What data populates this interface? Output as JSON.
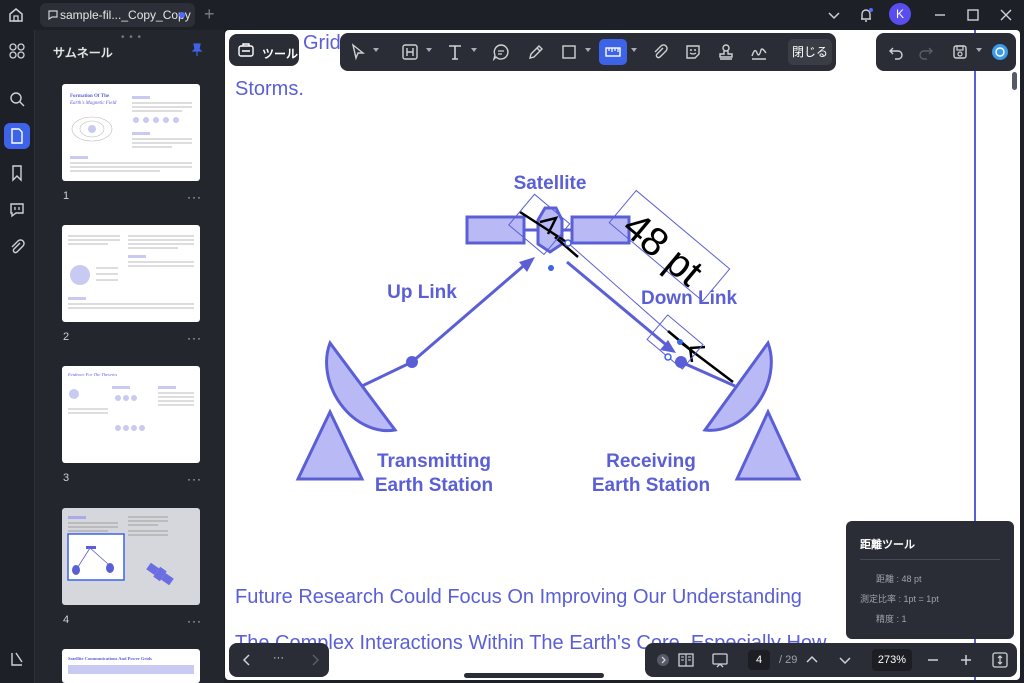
{
  "titlebar": {
    "tab_label": "sample-fil..._Copy_Copy",
    "avatar_letter": "K"
  },
  "sidebar": {
    "title": "サムネール",
    "pages": [
      "1",
      "2",
      "3",
      "4"
    ],
    "more_label": "···",
    "thumb1_heading": "Formation Of The",
    "thumb1_subheading": "Earth's Magnetic Field",
    "thumb3_heading": "Evidence For The Theories",
    "thumb5_heading": "Satellite Communications And Power Grids"
  },
  "toolbar": {
    "tool_label": "ツール",
    "close_label": "閉じる"
  },
  "document": {
    "heading_fragment": "Grid",
    "storms_text": "Storms.",
    "satellite_label": "Satellite",
    "uplink_label": "Up Link",
    "downlink_label": "Down Link",
    "transmit_line1": "Transmitting",
    "transmit_line2": "Earth Station",
    "receive_line1": "Receiving",
    "receive_line2": "Earth Station",
    "measure_label": "48 pt",
    "body_line1": "Future Research Could Focus On Improving Our Understanding",
    "body_line2": "The Complex Interactions Within The Earth's Core, Especially How"
  },
  "distance_panel": {
    "title": "距離ツール",
    "distance_label": "距離 : 48 pt",
    "scale_label": "測定比率 : 1pt = 1pt",
    "precision_label": "精度 : 1"
  },
  "bottom": {
    "nav_more": "···",
    "current_page": "4",
    "total_pages": "/ 29",
    "zoom": "273%"
  },
  "colors": {
    "accent": "#3d63e8",
    "diagram": "#5b5fd6",
    "diagram_fill": "#b9baf5"
  }
}
